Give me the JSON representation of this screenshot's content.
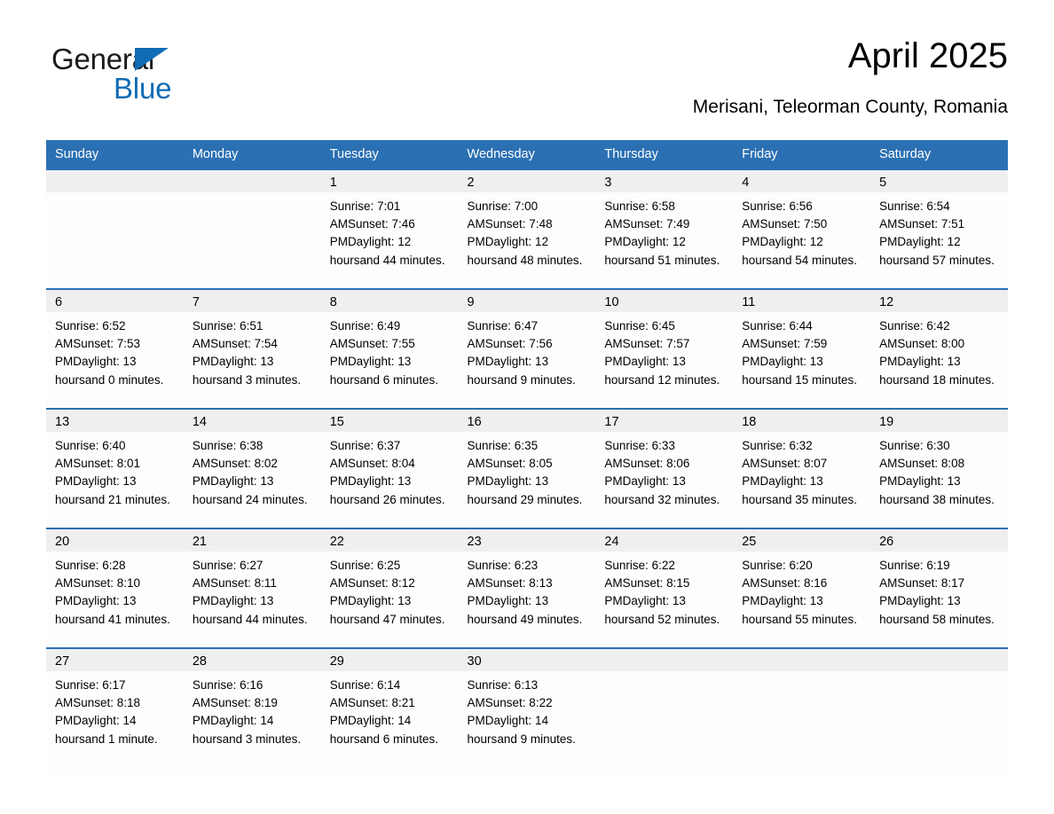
{
  "brand": {
    "name_part1": "General",
    "name_part2": "Blue",
    "triangle_icon": "triangle-icon",
    "accent_color": "#0f6cb5"
  },
  "header": {
    "title": "April 2025",
    "subtitle": "Merisani, Teleorman County, Romania"
  },
  "theme": {
    "header_bg": "#2b70b3",
    "daynum_bg": "#efefef",
    "body_bg": "#fdfdfd",
    "rule_color": "#2b70b3"
  },
  "columns": [
    "Sunday",
    "Monday",
    "Tuesday",
    "Wednesday",
    "Thursday",
    "Friday",
    "Saturday"
  ],
  "weeks": [
    [
      {
        "day": "",
        "lines": [
          "",
          "",
          "",
          ""
        ]
      },
      {
        "day": "",
        "lines": [
          "",
          "",
          "",
          ""
        ]
      },
      {
        "day": "1",
        "lines": [
          "Sunrise: 7:01 AM",
          "Sunset: 7:46 PM",
          "Daylight: 12 hours",
          "and 44 minutes."
        ]
      },
      {
        "day": "2",
        "lines": [
          "Sunrise: 7:00 AM",
          "Sunset: 7:48 PM",
          "Daylight: 12 hours",
          "and 48 minutes."
        ]
      },
      {
        "day": "3",
        "lines": [
          "Sunrise: 6:58 AM",
          "Sunset: 7:49 PM",
          "Daylight: 12 hours",
          "and 51 minutes."
        ]
      },
      {
        "day": "4",
        "lines": [
          "Sunrise: 6:56 AM",
          "Sunset: 7:50 PM",
          "Daylight: 12 hours",
          "and 54 minutes."
        ]
      },
      {
        "day": "5",
        "lines": [
          "Sunrise: 6:54 AM",
          "Sunset: 7:51 PM",
          "Daylight: 12 hours",
          "and 57 minutes."
        ]
      }
    ],
    [
      {
        "day": "6",
        "lines": [
          "Sunrise: 6:52 AM",
          "Sunset: 7:53 PM",
          "Daylight: 13 hours",
          "and 0 minutes."
        ]
      },
      {
        "day": "7",
        "lines": [
          "Sunrise: 6:51 AM",
          "Sunset: 7:54 PM",
          "Daylight: 13 hours",
          "and 3 minutes."
        ]
      },
      {
        "day": "8",
        "lines": [
          "Sunrise: 6:49 AM",
          "Sunset: 7:55 PM",
          "Daylight: 13 hours",
          "and 6 minutes."
        ]
      },
      {
        "day": "9",
        "lines": [
          "Sunrise: 6:47 AM",
          "Sunset: 7:56 PM",
          "Daylight: 13 hours",
          "and 9 minutes."
        ]
      },
      {
        "day": "10",
        "lines": [
          "Sunrise: 6:45 AM",
          "Sunset: 7:57 PM",
          "Daylight: 13 hours",
          "and 12 minutes."
        ]
      },
      {
        "day": "11",
        "lines": [
          "Sunrise: 6:44 AM",
          "Sunset: 7:59 PM",
          "Daylight: 13 hours",
          "and 15 minutes."
        ]
      },
      {
        "day": "12",
        "lines": [
          "Sunrise: 6:42 AM",
          "Sunset: 8:00 PM",
          "Daylight: 13 hours",
          "and 18 minutes."
        ]
      }
    ],
    [
      {
        "day": "13",
        "lines": [
          "Sunrise: 6:40 AM",
          "Sunset: 8:01 PM",
          "Daylight: 13 hours",
          "and 21 minutes."
        ]
      },
      {
        "day": "14",
        "lines": [
          "Sunrise: 6:38 AM",
          "Sunset: 8:02 PM",
          "Daylight: 13 hours",
          "and 24 minutes."
        ]
      },
      {
        "day": "15",
        "lines": [
          "Sunrise: 6:37 AM",
          "Sunset: 8:04 PM",
          "Daylight: 13 hours",
          "and 26 minutes."
        ]
      },
      {
        "day": "16",
        "lines": [
          "Sunrise: 6:35 AM",
          "Sunset: 8:05 PM",
          "Daylight: 13 hours",
          "and 29 minutes."
        ]
      },
      {
        "day": "17",
        "lines": [
          "Sunrise: 6:33 AM",
          "Sunset: 8:06 PM",
          "Daylight: 13 hours",
          "and 32 minutes."
        ]
      },
      {
        "day": "18",
        "lines": [
          "Sunrise: 6:32 AM",
          "Sunset: 8:07 PM",
          "Daylight: 13 hours",
          "and 35 minutes."
        ]
      },
      {
        "day": "19",
        "lines": [
          "Sunrise: 6:30 AM",
          "Sunset: 8:08 PM",
          "Daylight: 13 hours",
          "and 38 minutes."
        ]
      }
    ],
    [
      {
        "day": "20",
        "lines": [
          "Sunrise: 6:28 AM",
          "Sunset: 8:10 PM",
          "Daylight: 13 hours",
          "and 41 minutes."
        ]
      },
      {
        "day": "21",
        "lines": [
          "Sunrise: 6:27 AM",
          "Sunset: 8:11 PM",
          "Daylight: 13 hours",
          "and 44 minutes."
        ]
      },
      {
        "day": "22",
        "lines": [
          "Sunrise: 6:25 AM",
          "Sunset: 8:12 PM",
          "Daylight: 13 hours",
          "and 47 minutes."
        ]
      },
      {
        "day": "23",
        "lines": [
          "Sunrise: 6:23 AM",
          "Sunset: 8:13 PM",
          "Daylight: 13 hours",
          "and 49 minutes."
        ]
      },
      {
        "day": "24",
        "lines": [
          "Sunrise: 6:22 AM",
          "Sunset: 8:15 PM",
          "Daylight: 13 hours",
          "and 52 minutes."
        ]
      },
      {
        "day": "25",
        "lines": [
          "Sunrise: 6:20 AM",
          "Sunset: 8:16 PM",
          "Daylight: 13 hours",
          "and 55 minutes."
        ]
      },
      {
        "day": "26",
        "lines": [
          "Sunrise: 6:19 AM",
          "Sunset: 8:17 PM",
          "Daylight: 13 hours",
          "and 58 minutes."
        ]
      }
    ],
    [
      {
        "day": "27",
        "lines": [
          "Sunrise: 6:17 AM",
          "Sunset: 8:18 PM",
          "Daylight: 14 hours",
          "and 1 minute."
        ]
      },
      {
        "day": "28",
        "lines": [
          "Sunrise: 6:16 AM",
          "Sunset: 8:19 PM",
          "Daylight: 14 hours",
          "and 3 minutes."
        ]
      },
      {
        "day": "29",
        "lines": [
          "Sunrise: 6:14 AM",
          "Sunset: 8:21 PM",
          "Daylight: 14 hours",
          "and 6 minutes."
        ]
      },
      {
        "day": "30",
        "lines": [
          "Sunrise: 6:13 AM",
          "Sunset: 8:22 PM",
          "Daylight: 14 hours",
          "and 9 minutes."
        ]
      },
      {
        "day": "",
        "lines": [
          "",
          "",
          "",
          ""
        ]
      },
      {
        "day": "",
        "lines": [
          "",
          "",
          "",
          ""
        ]
      },
      {
        "day": "",
        "lines": [
          "",
          "",
          "",
          ""
        ]
      }
    ]
  ]
}
